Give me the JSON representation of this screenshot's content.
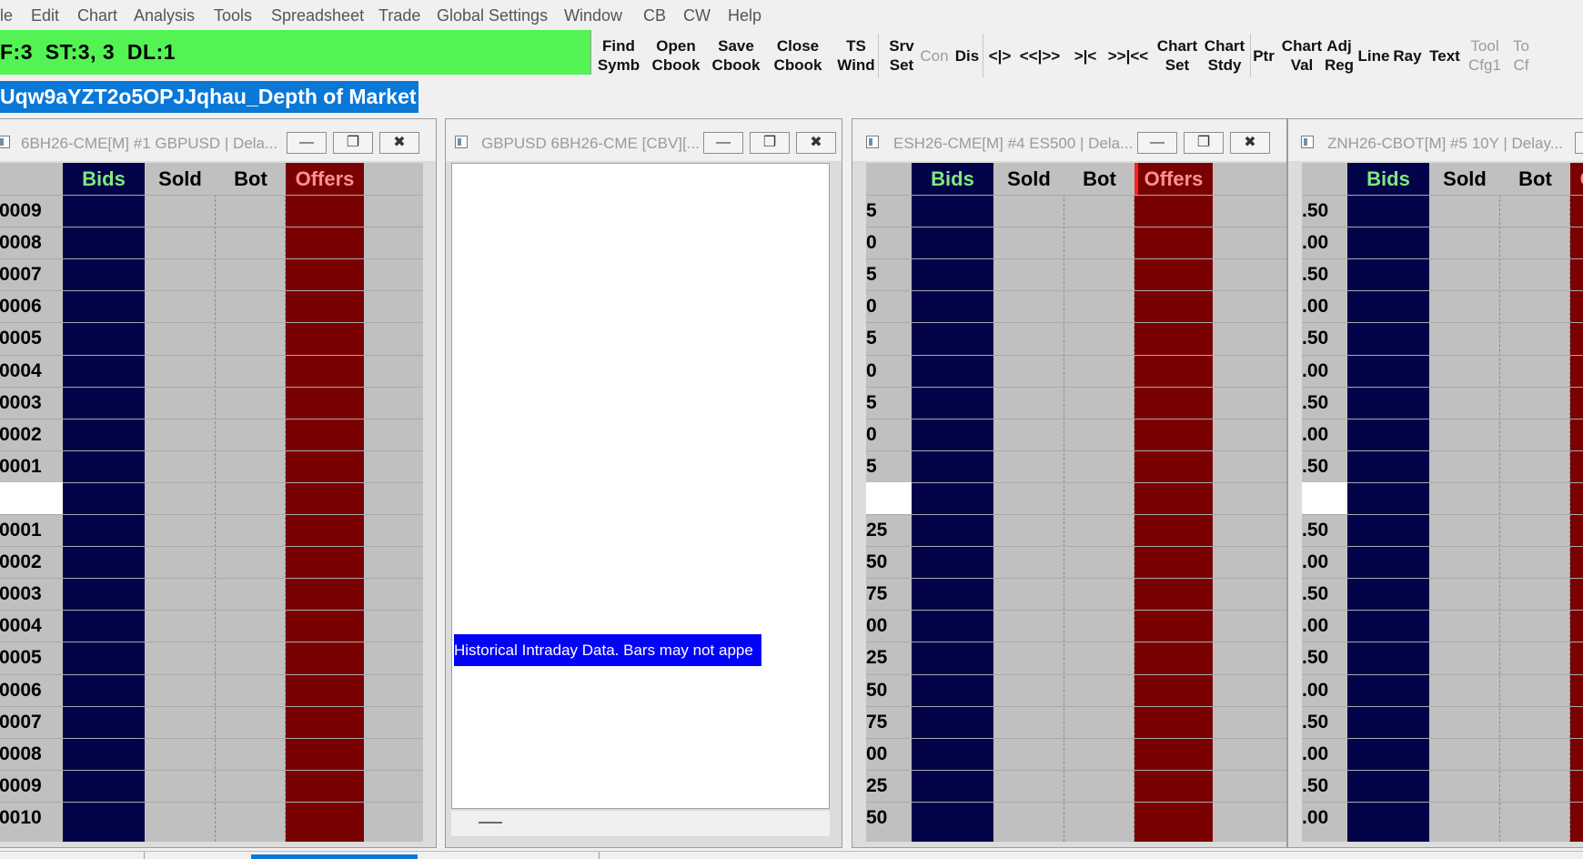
{
  "menu": [
    "le",
    "Edit",
    "Chart",
    "Analysis",
    "Tools",
    "Spreadsheet",
    "Trade",
    "Global Settings",
    "Window",
    "CB",
    "CW",
    "Help"
  ],
  "status": "F:3  ST:3, 3  DL:1",
  "toolbar": [
    {
      "line1": "Find",
      "line2": "Symb",
      "enabled": true
    },
    {
      "line1": "Open",
      "line2": "Cbook",
      "enabled": true
    },
    {
      "line1": "Save",
      "line2": "Cbook",
      "enabled": true
    },
    {
      "line1": "Close",
      "line2": "Cbook",
      "enabled": true
    },
    {
      "line1": "TS",
      "line2": "Wind",
      "enabled": true
    },
    {
      "line1": "Srv",
      "line2": "Set",
      "enabled": true
    },
    {
      "line1": "Con",
      "line2": "",
      "enabled": false
    },
    {
      "line1": "Dis",
      "line2": "",
      "enabled": true
    },
    {
      "line1": "<|>",
      "line2": "",
      "enabled": true
    },
    {
      "line1": "<<|>>",
      "line2": "",
      "enabled": true
    },
    {
      "line1": ">|<",
      "line2": "",
      "enabled": true
    },
    {
      "line1": ">>|<<",
      "line2": "",
      "enabled": true
    },
    {
      "line1": "Chart",
      "line2": "Set",
      "enabled": true
    },
    {
      "line1": "Chart",
      "line2": "Stdy",
      "enabled": true
    },
    {
      "line1": "Ptr",
      "line2": "",
      "enabled": true
    },
    {
      "line1": "Chart",
      "line2": "Val",
      "enabled": true
    },
    {
      "line1": "Adj",
      "line2": "Reg",
      "enabled": true
    },
    {
      "line1": "Line",
      "line2": "",
      "enabled": true
    },
    {
      "line1": "Ray",
      "line2": "",
      "enabled": true
    },
    {
      "line1": "Text",
      "line2": "",
      "enabled": true
    },
    {
      "line1": "Tool",
      "line2": "Cfg1",
      "enabled": false
    },
    {
      "line1": "To",
      "line2": "Cf",
      "enabled": false
    }
  ],
  "chartbook_title": "Uqw9aYZT2o5OPJJqhau_Depth of Market",
  "columns": {
    "bids": "Bids",
    "sold": "Sold",
    "bot": "Bot",
    "offers": "Offers"
  },
  "colors": {
    "bids": "#03034a",
    "offers": "#7a0101",
    "bids_text": "#7dea7d",
    "offers_text": "#ff9090",
    "grid": "#c0c0c0"
  },
  "windows": [
    {
      "title": "6BH26-CME[M] #1 GBPUSD | Dela...",
      "prices": [
        "0009",
        "0008",
        "0007",
        "0006",
        "0005",
        "0004",
        "0003",
        "0002",
        "0001",
        "",
        "0001",
        "0002",
        "0003",
        "0004",
        "0005",
        "0006",
        "0007",
        "0008",
        "0009",
        "0010"
      ]
    },
    {
      "title": "GBPUSD 6BH26-CME [CBV][...",
      "banner": "Historical Intraday Data.  Bars may not appe"
    },
    {
      "title": "ESH26-CME[M] #4 ES500 | Dela...",
      "prices": [
        "5",
        "0",
        "5",
        "0",
        "5",
        "0",
        "5",
        "0",
        "5",
        "",
        "25",
        "50",
        "75",
        "00",
        "25",
        "50",
        "75",
        "00",
        "25",
        "50"
      ]
    },
    {
      "title": "ZNH26-CBOT[M] #5 10Y | Delay...",
      "prices": [
        ".50",
        ".00",
        ".50",
        ".00",
        ".50",
        ".00",
        ".50",
        ".00",
        ".50",
        "",
        ".50",
        ".00",
        ".50",
        ".00",
        ".50",
        ".00",
        ".50",
        ".00",
        ".50",
        ".00"
      ]
    }
  ]
}
